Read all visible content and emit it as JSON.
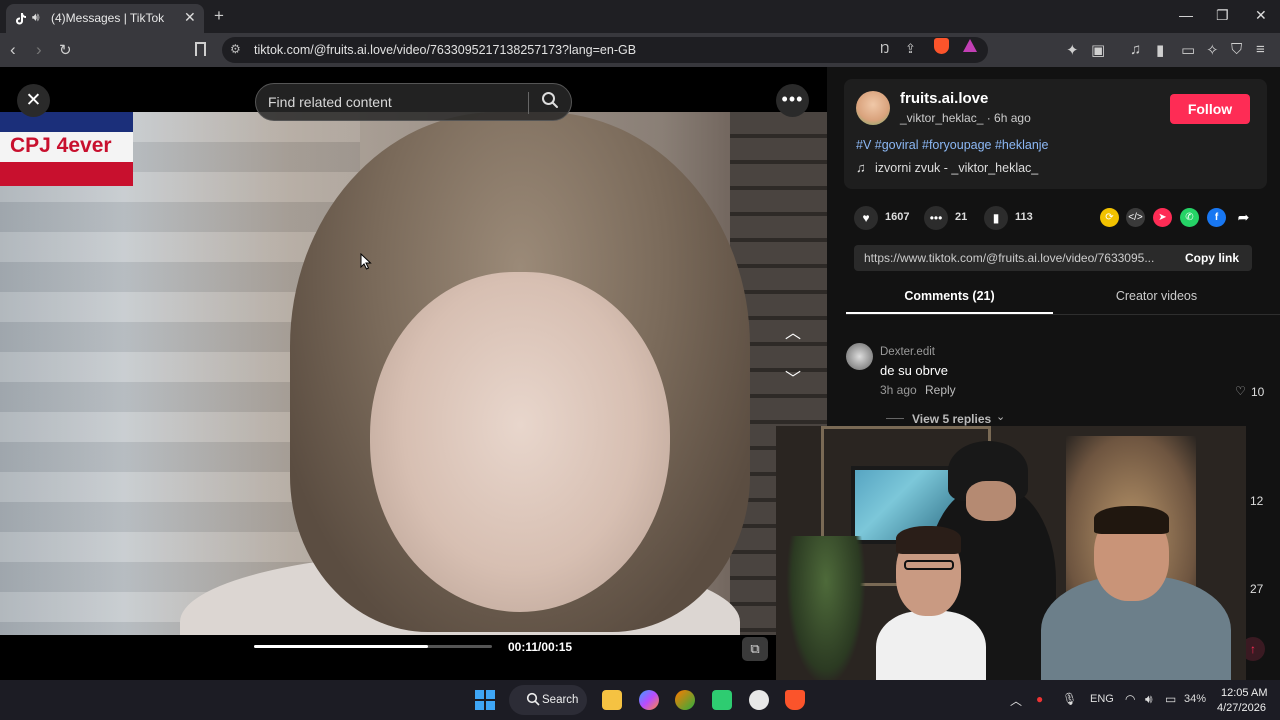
{
  "browser": {
    "tab_title": "(4)Messages | TikTok",
    "tab_audio_icon": "speaker-icon",
    "tab_close": "✕",
    "new_tab": "+",
    "win_min": "—",
    "win_max": "❐",
    "win_close": "✕",
    "url": "tiktok.com/@fruits.ai.love/video/7633095217138257173?lang=en-GB"
  },
  "video": {
    "watermark": "CPJ 4ever",
    "search_placeholder": "Find related content",
    "close_icon": "✕",
    "more_icon": "•••",
    "up_icon": "︿",
    "down_icon": "﹀",
    "time": "00:11/00:15",
    "progress_fraction": 0.733
  },
  "author": {
    "name": "fruits.ai.love",
    "sub": "_viktor_heklac_ · 6h ago",
    "follow": "Follow",
    "hashtags": "#V #goviral #foryoupage #heklanje",
    "music": "izvorni zvuk - _viktor_heklac_"
  },
  "stats": {
    "likes": "1607",
    "comments": "21",
    "saves": "113"
  },
  "share": {
    "link": "https://www.tiktok.com/@fruits.ai.love/video/7633095...",
    "copy": "Copy link"
  },
  "tabs": {
    "comments": "Comments (21)",
    "creator": "Creator videos"
  },
  "comments": [
    {
      "user": "Dexter.edit",
      "text": "de su obrve",
      "time": "3h ago",
      "reply": "Reply",
      "likes": "10",
      "view_replies": "View 5 replies"
    }
  ],
  "partial_counts": [
    "12",
    "27"
  ],
  "taskbar": {
    "search": "Search",
    "lang": "ENG",
    "battery": "34%",
    "time": "12:05 AM",
    "date": "4/27/2026"
  },
  "colors": {
    "follow": "#fe2c55",
    "hashtag": "#8cb8f5"
  }
}
